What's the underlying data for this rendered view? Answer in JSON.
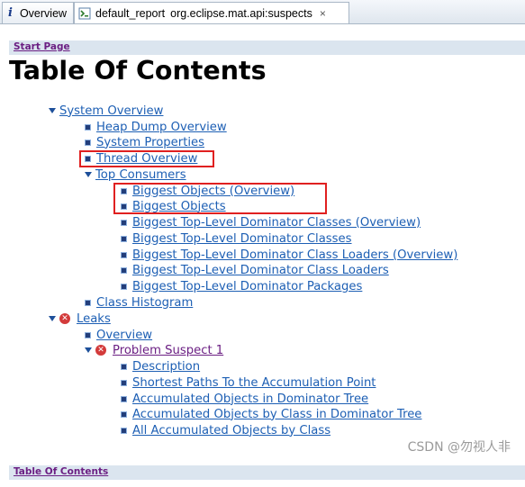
{
  "tabs": {
    "overview_label": "Overview",
    "report_label": "default_report",
    "report_subtitle": "org.eclipse.mat.api:suspects",
    "close_glyph": "×",
    "info_glyph": "i"
  },
  "header": {
    "start_page": "Start Page"
  },
  "title": "Table Of Contents",
  "toc": {
    "system_overview": "System Overview",
    "heap_dump_overview": "Heap Dump Overview",
    "system_properties": "System Properties",
    "thread_overview": "Thread Overview",
    "top_consumers": "Top Consumers",
    "biggest_objects_overview": "Biggest Objects (Overview)",
    "biggest_objects": "Biggest Objects",
    "biggest_top_level_dominator_classes_overview": "Biggest Top-Level Dominator Classes (Overview)",
    "biggest_top_level_dominator_classes": "Biggest Top-Level Dominator Classes",
    "biggest_top_level_dominator_class_loaders_overview": "Biggest Top-Level Dominator Class Loaders (Overview)",
    "biggest_top_level_dominator_class_loaders": "Biggest Top-Level Dominator Class Loaders",
    "biggest_top_level_dominator_packages": "Biggest Top-Level Dominator Packages",
    "class_histogram": "Class Histogram",
    "leaks": "Leaks",
    "leaks_overview": "Overview",
    "problem_suspect_1": "Problem Suspect 1",
    "description": "Description",
    "shortest_paths": "Shortest Paths To the Accumulation Point",
    "accumulated_objects_dominator_tree": "Accumulated Objects in Dominator Tree",
    "accumulated_objects_by_class_dominator_tree": "Accumulated Objects by Class in Dominator Tree",
    "all_accumulated_objects_by_class": "All Accumulated Objects by Class"
  },
  "footer": {
    "toc_link": "Table Of Contents"
  },
  "watermark": "CSDN @勿视人非",
  "colors": {
    "link": "#1d5fb4",
    "visited": "#6b1f83",
    "highlight": "#e02020",
    "bar": "#dbe5ef"
  }
}
